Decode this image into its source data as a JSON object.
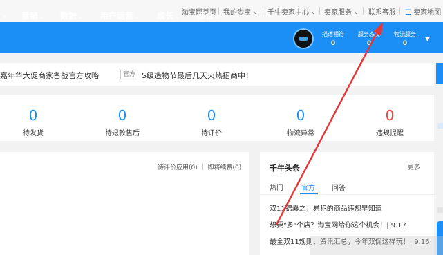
{
  "top_links": {
    "home": "淘宝网首页",
    "my_taobao": "我的淘宝",
    "seller_center": "千牛卖家中心",
    "seller_service": "卖家服务",
    "contact": "联系客服",
    "site_map": "卖家地图"
  },
  "nav": {
    "items": [
      "营销",
      "数据",
      "用户运营",
      "成长",
      "综合"
    ],
    "stats": [
      {
        "label": "描述相符",
        "value": "0"
      },
      {
        "label": "服务态度",
        "value": "0"
      },
      {
        "label": "物流服务",
        "value": "0"
      }
    ]
  },
  "notice": {
    "left": "嘉年华大促商家备战官方攻略",
    "badge": "官方",
    "right": "S级造物节最后几天火热招商中！"
  },
  "stats": [
    {
      "value": "0",
      "label": "待发货"
    },
    {
      "value": "0",
      "label": "待退款售后"
    },
    {
      "value": "0",
      "label": "待评价"
    },
    {
      "value": "0",
      "label": "物流异常"
    },
    {
      "value": "0",
      "label": "违规提醒"
    }
  ],
  "eval_links": "待评价应用(0) ｜ 即将续费(0)",
  "headlines": {
    "title": "千牛头条",
    "more": "更多",
    "tabs": [
      "热门",
      "官方",
      "问答"
    ],
    "items": [
      "双11锦囊之：易犯的商品违规早知道",
      "想要\"多\"个店？淘宝网给你这个机会！| 9.17",
      "最全双11规则、资讯汇总，今年双促这样玩！| 9.16"
    ]
  },
  "colors": {
    "brand_blue": "#1b8ff5",
    "alert_red": "#f5453b",
    "annotation_arrow": "#e0393b"
  }
}
